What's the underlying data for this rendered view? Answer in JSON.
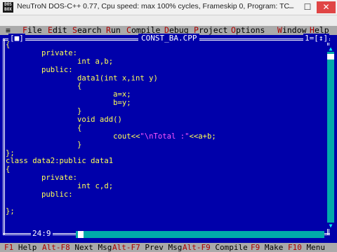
{
  "window": {
    "title": "NeuTroN DOS-C++ 0.77, Cpu speed: max 100% cycles, Frameskip  0, Program:      TC",
    "icon_label": "DOS BOX",
    "min_glyph": "–",
    "max_glyph": "☐",
    "close_glyph": "✕"
  },
  "menu": {
    "system": "≡",
    "items": [
      {
        "hot": "F",
        "rest": "ile"
      },
      {
        "hot": "E",
        "rest": "dit"
      },
      {
        "hot": "S",
        "rest": "earch"
      },
      {
        "hot": "R",
        "rest": "un"
      },
      {
        "hot": "C",
        "rest": "ompile"
      },
      {
        "hot": "D",
        "rest": "ebug"
      },
      {
        "hot": "P",
        "rest": "roject"
      },
      {
        "hot": "O",
        "rest": "ptions"
      },
      {
        "hot": "W",
        "rest": "indow"
      },
      {
        "hot": "H",
        "rest": "elp"
      }
    ]
  },
  "editor": {
    "close_box": "[■]",
    "filename": "CONST_BA.CPP",
    "window_number": "1=[↕]",
    "cursor_position": "24:9",
    "scroll_up": "▲",
    "scroll_down": "▼",
    "code_lines": [
      {
        "text": "{"
      },
      {
        "text": "        private:"
      },
      {
        "text": "                int a,b;"
      },
      {
        "text": "        public:"
      },
      {
        "text": "                data1(int x,int y)"
      },
      {
        "text": "                {"
      },
      {
        "text": "                        a=x;"
      },
      {
        "text": "                        b=y;"
      },
      {
        "text": "                }"
      },
      {
        "text": "                void add()"
      },
      {
        "text": "                {"
      },
      {
        "text": "                        cout<<",
        "str": "\"\\nTotal :\"",
        "after": "<<a+b;"
      },
      {
        "text": "                }"
      },
      {
        "text": "};"
      },
      {
        "text": "class data2:public data1"
      },
      {
        "text": "{"
      },
      {
        "text": "        private:"
      },
      {
        "text": "                int c,d;"
      },
      {
        "text": "        public:"
      },
      {
        "text": ""
      },
      {
        "text": "};"
      }
    ]
  },
  "statusbar": {
    "items": [
      {
        "key": "F1",
        "label": "Help"
      },
      {
        "key": "Alt-F8",
        "label": "Next Msg"
      },
      {
        "key": "Alt-F7",
        "label": "Prev Msg"
      },
      {
        "key": "Alt-F9",
        "label": "Compile"
      },
      {
        "key": "F9",
        "label": "Make"
      },
      {
        "key": "F10",
        "label": "Menu"
      }
    ]
  },
  "colors": {
    "editor_bg": "#0000aa",
    "code_text": "#ffff55",
    "string_literal": "#ff55ff",
    "menu_bg": "#aaaaaa",
    "hotkey": "#aa0000",
    "scrollbar": "#00aaaa"
  }
}
